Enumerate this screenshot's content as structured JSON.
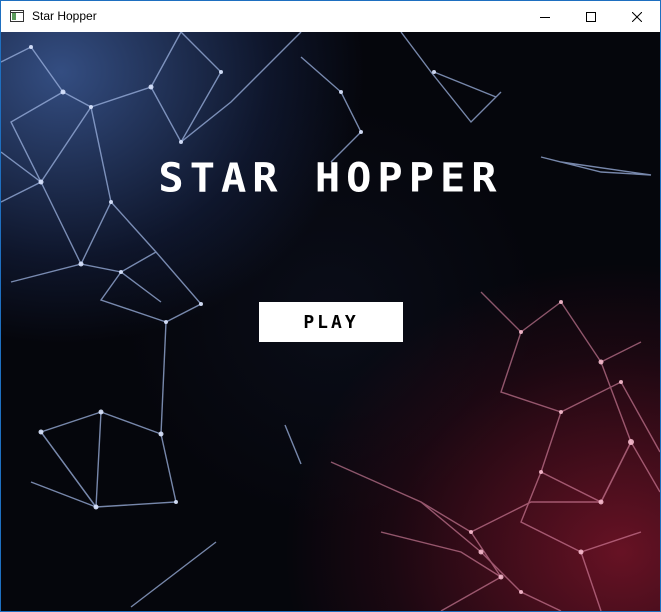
{
  "window": {
    "title": "Star Hopper",
    "icons": {
      "app": "app-window-icon",
      "minimize": "minimize-icon",
      "maximize": "maximize-icon",
      "close": "close-icon"
    }
  },
  "game": {
    "title": "Star Hopper",
    "play_label": "PLAY"
  },
  "colors": {
    "background": "#06070d",
    "accent_blue": "#8aa4d6",
    "accent_red": "#c0607e",
    "title_text": "#ffffff",
    "button_bg": "#ffffff",
    "button_text": "#000000"
  }
}
